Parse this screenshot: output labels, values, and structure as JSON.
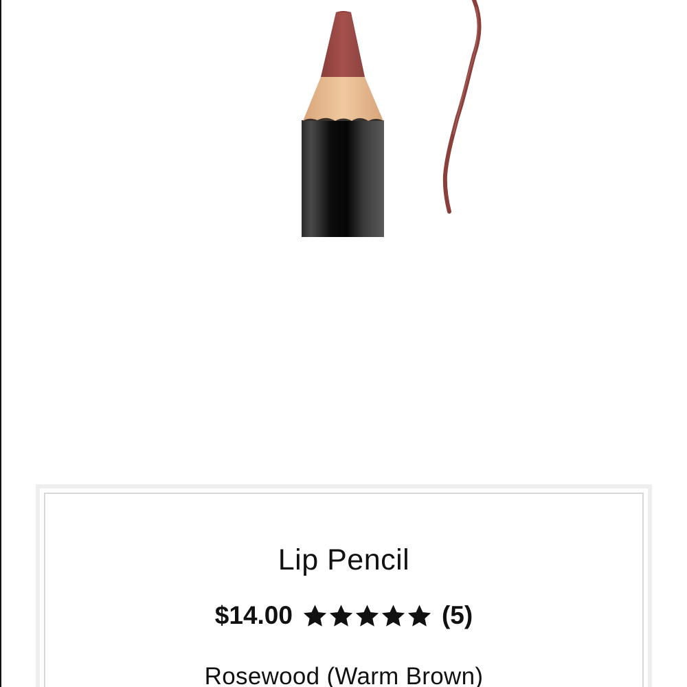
{
  "product": {
    "name": "Lip Pencil",
    "price": "$14.00",
    "rating": 5,
    "rating_max": 5,
    "review_count": "(5)",
    "shade": "Rosewood (Warm Brown)"
  },
  "image": {
    "icon": "lip-pencil-product-photo",
    "swatch_color": "#8a3f3a",
    "lead_color": "#9b4f4c",
    "wood_color": "#e6b98e",
    "barrel_color": "#1a1a1a"
  }
}
